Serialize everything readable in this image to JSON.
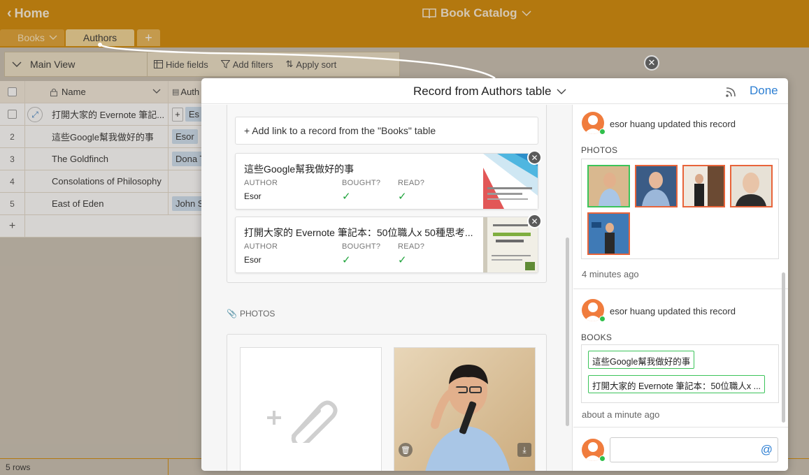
{
  "app": {
    "home_label": "Home",
    "title": "Book Catalog"
  },
  "tabs": {
    "books": "Books",
    "authors": "Authors",
    "add": "+"
  },
  "toolbar": {
    "view": "Main View",
    "hide_fields": "Hide fields",
    "add_filters": "Add filters",
    "apply_sort": "Apply sort"
  },
  "grid": {
    "name_header": "Name",
    "link_header": "Auth",
    "rows": [
      {
        "num": "",
        "name": "打開大家的 Evernote 筆記...",
        "link": "Es"
      },
      {
        "num": "2",
        "name": "這些Google幫我做好的事",
        "link": "Esor"
      },
      {
        "num": "3",
        "name": "The Goldfinch",
        "link": "Dona T"
      },
      {
        "num": "4",
        "name": "Consolations of Philosophy",
        "link": ""
      },
      {
        "num": "5",
        "name": "East of Eden",
        "link": "John S"
      }
    ],
    "add_row": "+",
    "row_count": "5 rows"
  },
  "modal": {
    "title": "Record from Authors table",
    "done": "Done",
    "add_link": "+ Add link to a record from the \"Books\" table",
    "linked_records": [
      {
        "title": "這些Google幫我做好的事",
        "author_label": "AUTHOR",
        "author": "Esor",
        "bought_label": "BOUGHT?",
        "read_label": "READ?"
      },
      {
        "title": "打開大家的 Evernote 筆記本：50位職人x 50種思考...",
        "author_label": "AUTHOR",
        "author": "Esor",
        "bought_label": "BOUGHT?",
        "read_label": "READ?"
      }
    ],
    "photos_label": "PHOTOS"
  },
  "activity": [
    {
      "user": "esor huang updated this record",
      "field": "PHOTOS",
      "time": "4 minutes ago"
    },
    {
      "user": "esor huang updated this record",
      "field": "BOOKS",
      "books": [
        "這些Google幫我做好的事",
        "打開大家的 Evernote 筆記本：50位職人x ..."
      ],
      "time": "about a minute ago"
    }
  ],
  "comment": {
    "at_symbol": "@"
  },
  "colors": {
    "brand": "#d38a06",
    "accent": "#2d7fd3",
    "online": "#2fbf4a",
    "check": "#1fa33b"
  }
}
